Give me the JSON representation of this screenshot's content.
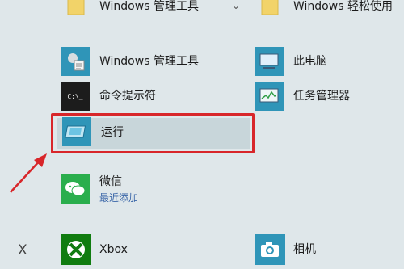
{
  "apps": {
    "folder_tools": {
      "label": "Windows 管理工具",
      "icon": "folder-icon"
    },
    "folder_ease": {
      "label": "Windows 轻松使用",
      "icon": "folder-icon"
    },
    "admin_tools": {
      "label": "Windows 管理工具",
      "icon": "admin-tools-icon"
    },
    "this_pc": {
      "label": "此电脑",
      "icon": "computer-icon"
    },
    "cmd": {
      "label": "命令提示符",
      "icon": "terminal-icon",
      "icon_text": "C:\\_"
    },
    "task_manager": {
      "label": "任务管理器",
      "icon": "task-manager-icon"
    },
    "run": {
      "label": "运行",
      "icon": "run-icon"
    },
    "wechat": {
      "label": "微信",
      "sublabel": "最近添加",
      "icon": "wechat-icon"
    },
    "xbox": {
      "label": "Xbox",
      "icon": "xbox-icon"
    },
    "camera": {
      "label": "相机",
      "icon": "camera-icon"
    }
  },
  "section_letter": "X",
  "annotation": {
    "highlight_color": "#d8262a"
  }
}
